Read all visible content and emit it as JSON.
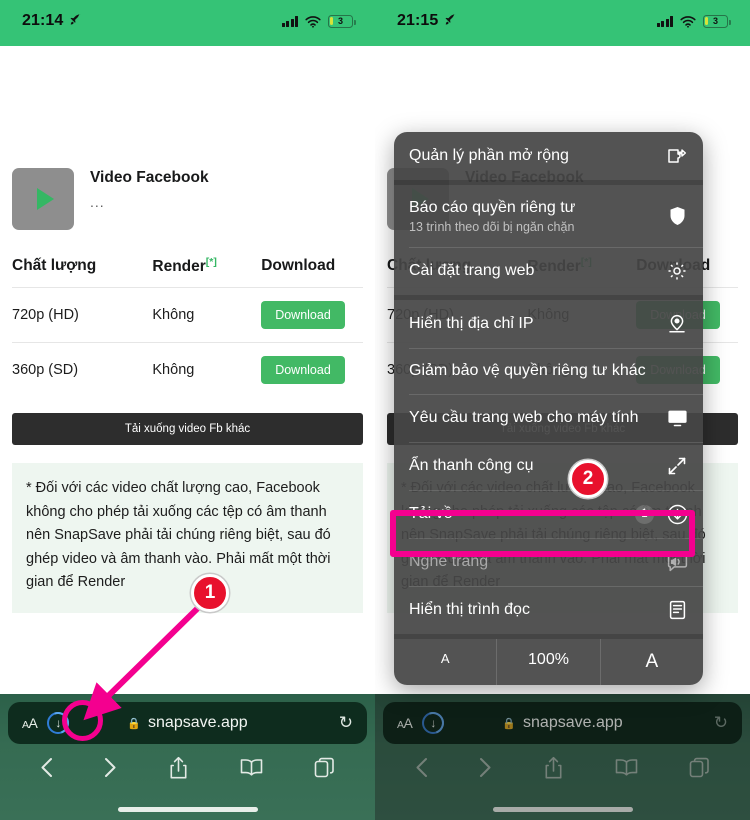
{
  "left": {
    "status": {
      "time": "21:14",
      "battery_level": "3",
      "rocket_icon": "rocket-icon",
      "wifi_icon": "wifi-icon",
      "signal_icon": "signal-bars-icon"
    },
    "page": {
      "video_title": "Video Facebook",
      "video_subtitle": "...",
      "thumb_icon": "play-icon",
      "table": {
        "headers": [
          "Chất lượng",
          "Render",
          "Download"
        ],
        "render_star": "[*]",
        "rows": [
          {
            "quality": "720p (HD)",
            "render": "Không",
            "action": "Download"
          },
          {
            "quality": "360p (SD)",
            "render": "Không",
            "action": "Download"
          }
        ]
      },
      "other_button": "Tải xuống video Fb khác",
      "note": "* Đối với các video chất lượng cao, Facebook không cho phép tải xuống các tệp có âm thanh nên SnapSave phải tải chúng riêng biệt, sau đó ghép video và âm thanh vào. Phải mất một thời gian để Render"
    },
    "chrome": {
      "aa_label": "AA",
      "download_icon": "download-progress-icon",
      "lock_icon": "lock-icon",
      "url": "snapsave.app",
      "reload_icon": "reload-icon",
      "nav": [
        "back-icon",
        "forward-icon",
        "share-icon",
        "bookmarks-icon",
        "tabs-icon"
      ]
    }
  },
  "right": {
    "status": {
      "time": "21:15",
      "battery_level": "3",
      "rocket_icon": "rocket-icon",
      "wifi_icon": "wifi-icon",
      "signal_icon": "signal-bars-icon"
    },
    "menu": {
      "items": [
        {
          "label": "Quản lý phần mở rộng",
          "sub": "",
          "icon": "extension-icon",
          "count": "",
          "dimmed": false,
          "gap": false
        },
        {
          "label": "Báo cáo quyền riêng tư",
          "sub": "13 trình theo dõi bị ngăn chặn",
          "icon": "shield-icon",
          "count": "",
          "dimmed": false,
          "gap": true
        },
        {
          "label": "Cài đặt trang web",
          "sub": "",
          "icon": "gear-icon",
          "count": "",
          "dimmed": false,
          "gap": false
        },
        {
          "label": "Hiển thị địa chỉ IP",
          "sub": "",
          "icon": "location-pin-icon",
          "count": "",
          "dimmed": false,
          "gap": true
        },
        {
          "label": "Giảm bảo vệ quyền riêng tư khác",
          "sub": "",
          "icon": "",
          "count": "",
          "dimmed": false,
          "gap": false
        },
        {
          "label": "Yêu cầu trang web cho máy tính",
          "sub": "",
          "icon": "desktop-icon",
          "count": "",
          "dimmed": false,
          "gap": false
        },
        {
          "label": "Ẩn thanh công cụ",
          "sub": "",
          "icon": "expand-arrows-icon",
          "count": "",
          "dimmed": false,
          "gap": false
        },
        {
          "label": "Tải về",
          "sub": "",
          "icon": "download-circle-icon",
          "count": "1",
          "dimmed": false,
          "gap": false
        },
        {
          "label": "Nghe trang",
          "sub": "",
          "icon": "speaker-bubble-icon",
          "count": "",
          "dimmed": true,
          "gap": false
        },
        {
          "label": "Hiển thị trình đọc",
          "sub": "",
          "icon": "reader-icon",
          "count": "",
          "dimmed": false,
          "gap": false
        }
      ],
      "zoom_row": {
        "decrease": "A",
        "level": "100%",
        "increase": "A"
      }
    },
    "chrome": {
      "aa_label": "AA",
      "download_icon": "download-progress-icon",
      "lock_icon": "lock-icon",
      "url": "snapsave.app",
      "reload_icon": "reload-icon"
    }
  },
  "annotations": {
    "step1": "1",
    "step2": "2",
    "highlight_color": "#f4008f",
    "badge_color": "#e8112d"
  }
}
